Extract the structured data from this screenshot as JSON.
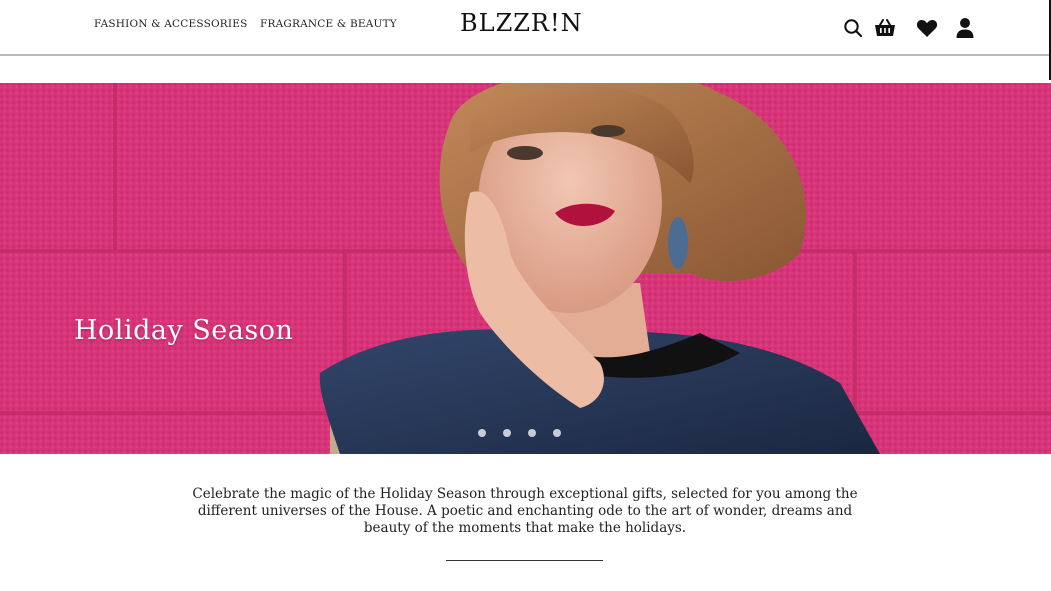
{
  "header": {
    "nav": [
      {
        "label": "FASHION & ACCESSORIES"
      },
      {
        "label": "FRAGRANCE & BEAUTY"
      }
    ],
    "logo": "BLZZR!N",
    "icons": [
      "search-icon",
      "basket-icon",
      "heart-icon",
      "user-icon"
    ]
  },
  "hero": {
    "title": "Holiday Season",
    "background_color": "#d6336f",
    "slides_count": 4
  },
  "description": {
    "text": "Celebrate the magic of the Holiday Season through exceptional gifts, selected for you among the different universes of the House. A poetic and enchanting ode to the art of wonder, dreams and beauty of the moments that make the holidays."
  }
}
